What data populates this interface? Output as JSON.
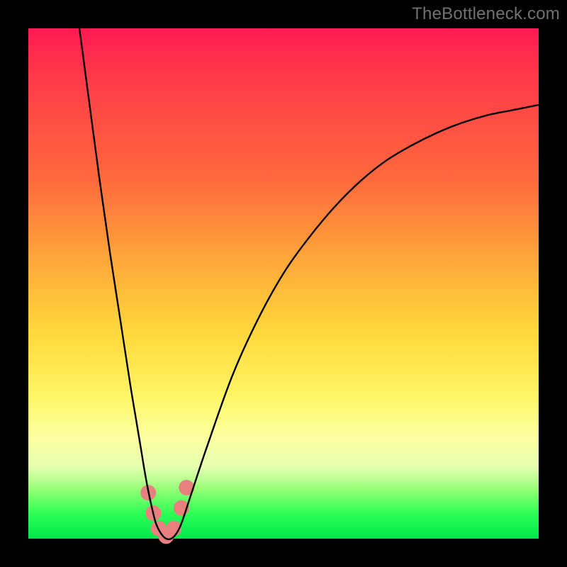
{
  "watermark": "TheBottleneck.com",
  "chart_data": {
    "type": "line",
    "title": "",
    "xlabel": "",
    "ylabel": "",
    "xlim": [
      0,
      100
    ],
    "ylim": [
      0,
      100
    ],
    "grid": false,
    "series": [
      {
        "name": "curve",
        "color": "#000000",
        "x": [
          10,
          12,
          14,
          16,
          18,
          20,
          21,
          22,
          23,
          24,
          25,
          26,
          27,
          28,
          29,
          30,
          32,
          35,
          40,
          45,
          50,
          55,
          60,
          65,
          70,
          75,
          80,
          85,
          90,
          95,
          100
        ],
        "y": [
          100,
          85,
          70,
          56,
          43,
          30,
          24,
          18,
          12,
          7,
          3,
          1,
          0,
          0,
          1,
          3,
          9,
          18,
          32,
          43,
          52,
          59,
          65,
          70,
          74,
          77,
          79.5,
          81.5,
          83,
          84,
          85
        ]
      }
    ],
    "markers": [
      {
        "name": "minimum-marker",
        "color": "#e98080",
        "shape": "round",
        "points": [
          {
            "x": 23.5,
            "y": 9
          },
          {
            "x": 24.5,
            "y": 5
          },
          {
            "x": 25.5,
            "y": 2
          },
          {
            "x": 27.0,
            "y": 0.5
          },
          {
            "x": 28.5,
            "y": 2
          },
          {
            "x": 30.0,
            "y": 6
          },
          {
            "x": 31.0,
            "y": 10
          }
        ]
      }
    ]
  }
}
